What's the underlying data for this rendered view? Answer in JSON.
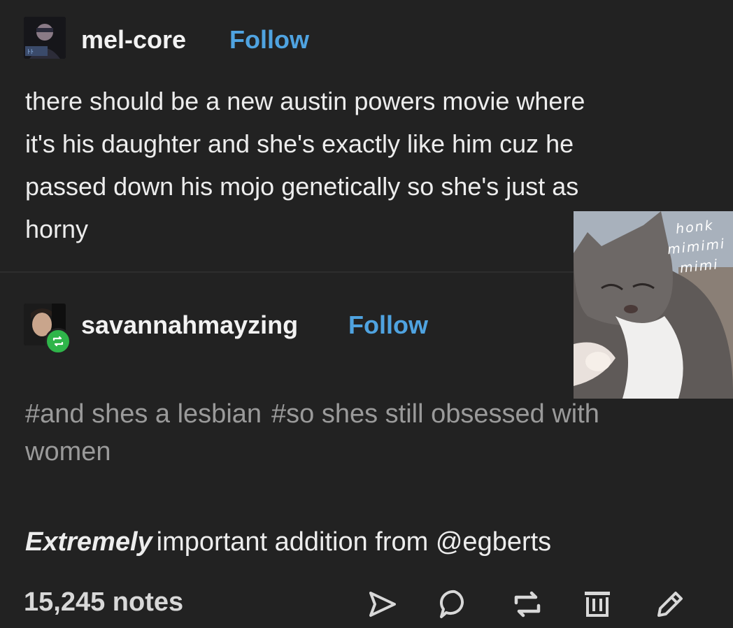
{
  "post": {
    "author": "mel-core",
    "follow_label": "Follow",
    "text_lines": [
      "there should be a new austin powers movie where",
      "it's his daughter and she's exactly like him cuz he",
      "passed down his mojo genetically so she's just as",
      "horny"
    ]
  },
  "reblog": {
    "author": "savannahmayzing",
    "follow_label": "Follow",
    "tags": [
      "#and shes a lesbian",
      "#so shes still obsessed with women"
    ]
  },
  "addition": {
    "emphasis": "Extremely",
    "text": "important addition from @egberts"
  },
  "footer": {
    "notes": "15,245 notes",
    "actions": [
      "share-icon",
      "reply-icon",
      "reblog-icon",
      "delete-icon",
      "edit-icon"
    ]
  },
  "cat_image": {
    "caption_lines": [
      "honk",
      "mimimi",
      "mimi"
    ]
  },
  "colors": {
    "background": "#222222",
    "follow": "#4fa3e0",
    "reblog_badge": "#2fb54a",
    "tags": "#9a9a9a"
  }
}
